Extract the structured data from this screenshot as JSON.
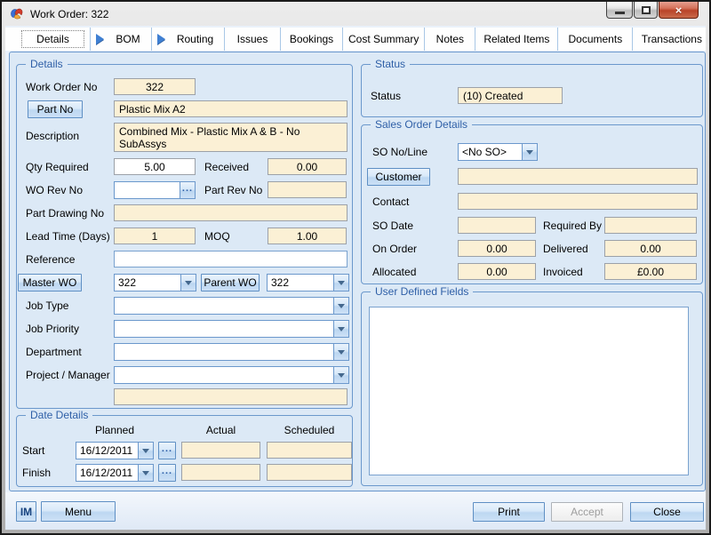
{
  "window": {
    "title": "Work Order: 322"
  },
  "icons": {
    "app": "work-order-app",
    "minimize": "minimize",
    "maximize": "maximize",
    "close": "×",
    "tab_arrow": "play",
    "dropdown": "chevron-down",
    "ellipsis": "..."
  },
  "tabs": [
    {
      "label": "Details",
      "selected": true,
      "arrow": false
    },
    {
      "label": "BOM",
      "selected": false,
      "arrow": true
    },
    {
      "label": "Routing",
      "selected": false,
      "arrow": true
    },
    {
      "label": "Issues",
      "selected": false,
      "arrow": false
    },
    {
      "label": "Bookings",
      "selected": false,
      "arrow": false
    },
    {
      "label": "Cost Summary",
      "selected": false,
      "arrow": false
    },
    {
      "label": "Notes",
      "selected": false,
      "arrow": false
    },
    {
      "label": "Related Items",
      "selected": false,
      "arrow": false
    },
    {
      "label": "Documents",
      "selected": false,
      "arrow": false
    },
    {
      "label": "Transactions",
      "selected": false,
      "arrow": false
    }
  ],
  "details": {
    "legend": "Details",
    "rows": {
      "work_order_no": {
        "label": "Work Order No",
        "value": "322"
      },
      "part_no": {
        "button_label": "Part No",
        "value": "Plastic Mix A2"
      },
      "description": {
        "label": "Description",
        "value": "Combined Mix - Plastic Mix A & B - No SubAssys"
      },
      "qty_required": {
        "label": "Qty Required",
        "value": "5.00"
      },
      "received": {
        "label": "Received",
        "value": "0.00"
      },
      "wo_rev_no": {
        "label": "WO Rev No",
        "value": ""
      },
      "part_rev_no": {
        "label": "Part Rev No",
        "value": ""
      },
      "part_drawing_no": {
        "label": "Part Drawing No",
        "value": ""
      },
      "lead_time_days": {
        "label": "Lead Time (Days)",
        "value": "1"
      },
      "moq": {
        "label": "MOQ",
        "value": "1.00"
      },
      "reference": {
        "label": "Reference",
        "value": ""
      },
      "master_wo": {
        "button_label": "Master WO",
        "value": "322"
      },
      "parent_wo": {
        "button_label": "Parent WO",
        "value": "322"
      },
      "job_type": {
        "label": "Job Type",
        "value": ""
      },
      "job_priority": {
        "label": "Job Priority",
        "value": ""
      },
      "department": {
        "label": "Department",
        "value": ""
      },
      "project_manager": {
        "label": "Project / Manager",
        "value": ""
      },
      "project_detail": {
        "value": ""
      }
    }
  },
  "date_details": {
    "legend": "Date Details",
    "columns": [
      "Planned",
      "Actual",
      "Scheduled"
    ],
    "rows": [
      {
        "label": "Start",
        "planned": "16/12/2011",
        "actual": "",
        "scheduled": ""
      },
      {
        "label": "Finish",
        "planned": "16/12/2011",
        "actual": "",
        "scheduled": ""
      }
    ]
  },
  "status_group": {
    "legend": "Status",
    "label": "Status",
    "value": "(10) Created"
  },
  "sales_order": {
    "legend": "Sales Order Details",
    "so_no_line": {
      "label": "SO No/Line",
      "value": "<No SO>"
    },
    "customer": {
      "button_label": "Customer",
      "value": ""
    },
    "contact": {
      "label": "Contact",
      "value": ""
    },
    "so_date": {
      "label": "SO Date",
      "value": ""
    },
    "required_by": {
      "label": "Required By",
      "value": ""
    },
    "on_order": {
      "label": "On Order",
      "value": "0.00"
    },
    "delivered": {
      "label": "Delivered",
      "value": "0.00"
    },
    "allocated": {
      "label": "Allocated",
      "value": "0.00"
    },
    "invoiced": {
      "label": "Invoiced",
      "value": "£0.00"
    }
  },
  "user_defined": {
    "legend": "User Defined Fields",
    "content": ""
  },
  "footer": {
    "im": "IM",
    "menu": "Menu",
    "print": "Print",
    "accept": "Accept",
    "close": "Close"
  },
  "colors": {
    "panel_bg": "#DCE9F6",
    "group_border": "#6B98CC",
    "legend_blue": "#2E5FA7",
    "field_cream": "#FBF0D5",
    "button_blue_top": "#EAF3FC",
    "button_blue_bottom": "#CBE0F6",
    "close_red": "#B94328",
    "tab_arrow_blue": "#3F7FD2"
  }
}
